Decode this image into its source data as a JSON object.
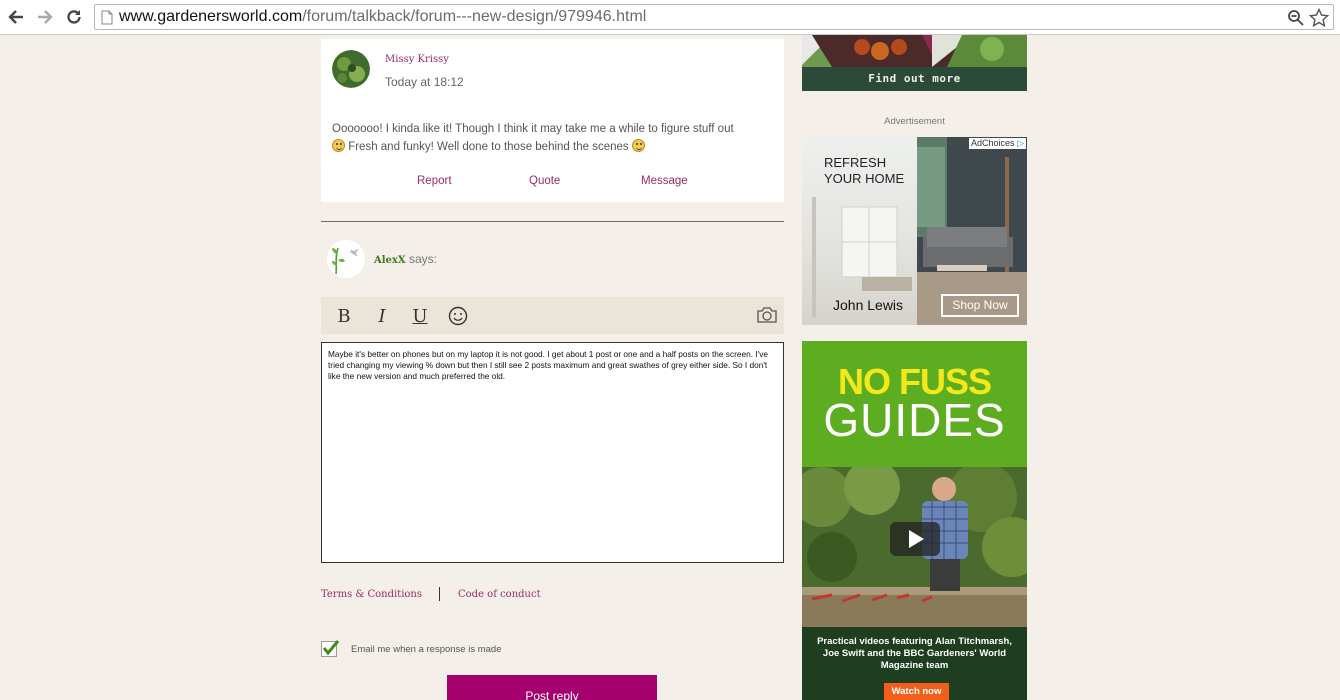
{
  "browser": {
    "url_host": "www.gardenersworld.com",
    "url_path": "/forum/talkback/forum---new-design/979946.html"
  },
  "post": {
    "author": "Missy Krissy",
    "time": "Today at 18:12",
    "body_line1": "Ooooooo!  I kinda like it!  Though I think it may take me a while to figure stuff out",
    "body_line2": " Fresh and funky! Well done to those behind the scenes ",
    "actions": {
      "report": "Report",
      "quote": "Quote",
      "message": "Message"
    }
  },
  "reply": {
    "author": "AlexX",
    "says": " says:",
    "toolbar": {
      "bold": "B",
      "italic": "I",
      "underline": "U"
    },
    "text": "Maybe it's better on phones but on my laptop it is not good. I get about 1 post or one and a half posts on the screen. I've tried changing my viewing % down but then I still see 2 posts maximum and great swathes of grey either side. So I don't like the new version and much preferred the old.",
    "terms": "Terms & Conditions",
    "conduct": "Code of conduct",
    "email_label": "Email me when a response is made",
    "email_checked": true,
    "submit": "Post reply"
  },
  "ads": {
    "top_banner": "Find out more",
    "caption": "Advertisement",
    "john_lewis": {
      "headline_1": "REFRESH",
      "headline_2": "YOUR HOME",
      "brand": "John Lewis",
      "cta": "Shop Now",
      "adchoices": "AdChoices"
    },
    "no_fuss": {
      "title_1": "NO FUSS",
      "title_2": "GUIDES",
      "caption": "Practical videos featuring Alan Titchmarsh, Joe Swift and the BBC Gardeners' World Magazine team",
      "cta": "Watch now"
    }
  }
}
